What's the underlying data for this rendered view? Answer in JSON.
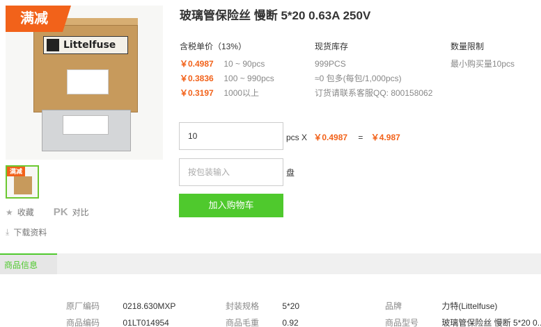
{
  "gallery": {
    "promo_badge": "满减",
    "thumb_promo_badge": "满减",
    "box_brand_text": "Littelfuse"
  },
  "actions": {
    "favorite_label": "收藏",
    "compare_mark": "PK",
    "compare_label": "对比",
    "download_label": "下载资料"
  },
  "product": {
    "title": "玻璃管保险丝 慢断 5*20 0.63A 250V"
  },
  "pricing": {
    "header": "含税单价（13%）",
    "tiers": [
      {
        "price": "￥0.4987",
        "range": "10 ~ 90pcs"
      },
      {
        "price": "￥0.3836",
        "range": "100 ~ 990pcs"
      },
      {
        "price": "￥0.3197",
        "range": "1000以上"
      }
    ]
  },
  "stock": {
    "header": "现货库存",
    "quantity": "999PCS",
    "package_info": "≈0 包多(每包/1,000pcs)",
    "order_contact": "订货请联系客服QQ: 800158062"
  },
  "limit": {
    "header": "数量限制",
    "min_order": "最小购买量10pcs"
  },
  "order": {
    "qty_value": "10",
    "unit_x": "pcs X",
    "unit_price": "￥0.4987",
    "equals": "=",
    "total": "￥4.987",
    "pack_placeholder": "按包装输入",
    "pack_unit": "盘",
    "add_to_cart": "加入购物车"
  },
  "tabs": {
    "active": "商品信息"
  },
  "specs": [
    {
      "key": "原厂编码",
      "value": "0218.630MXP"
    },
    {
      "key": "封装规格",
      "value": "5*20"
    },
    {
      "key": "品牌",
      "value": "力特(Littelfuse)"
    },
    {
      "key": "商品编码",
      "value": "01LT014954"
    },
    {
      "key": "商品毛重",
      "value": "0.92"
    },
    {
      "key": "商品型号",
      "value": "玻璃管保险丝 慢断 5*20 0..."
    }
  ],
  "colors": {
    "accent_orange": "#f2621a",
    "cart_green": "#4fc92d"
  }
}
